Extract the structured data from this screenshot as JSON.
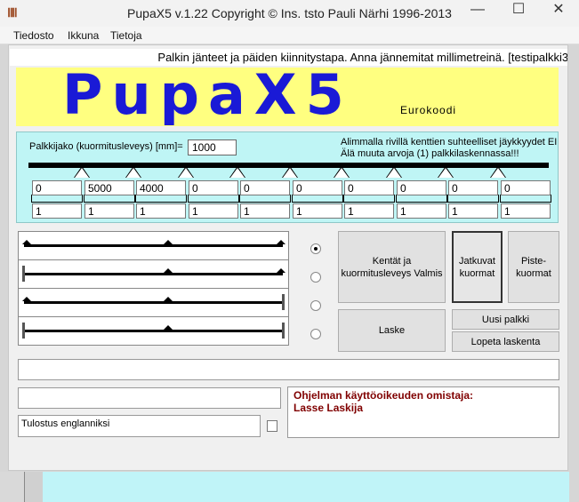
{
  "window": {
    "app_icon": "ⅡⅡ",
    "title": "PupaX5 v.1.22    Copyright © Ins. tsto Pauli Närhi 1996-2013",
    "controls": [
      "minimize",
      "maximize",
      "close"
    ]
  },
  "menu": [
    "Tiedosto",
    "Ikkuna",
    "Tietoja"
  ],
  "header_text": "Palkin jänteet ja päiden kiinnitystapa. Anna jännemitat millimetreinä. [testipalkki3...",
  "logo": {
    "title": "PupaX5",
    "subtitle": "Eurokoodi"
  },
  "beam": {
    "spacing_label": "Palkkijako (kuormitusleveys) [mm]=",
    "spacing_value": "1000",
    "note_line1": "Alimmalla rivillä kenttien suhteelliset jäykkyydet EI",
    "note_line2": "Älä muuta arvoja (1) palkkilaskennassa!!!",
    "spans": [
      "0",
      "5000",
      "4000",
      "0",
      "0",
      "0",
      "0",
      "0",
      "0",
      "0"
    ],
    "stiffness": [
      "1",
      "1",
      "1",
      "1",
      "1",
      "1",
      "1",
      "1",
      "1",
      "1"
    ]
  },
  "support_types": {
    "options": [
      "simply-supported",
      "fixed-left",
      "fixed-right",
      "fixed-both"
    ],
    "selected_index": 0
  },
  "buttons": {
    "fields_ready": "Kentät ja kuormitusleveys Valmis",
    "continuous_loads": "Jatkuvat kuormat",
    "point_loads": "Piste-kuormat",
    "calculate": "Laske",
    "new_beam": "Uusi palkki",
    "stop_calculation": "Lopeta laskenta"
  },
  "status_field": "",
  "secondary_field": "",
  "output_english_label": "Tulostus englanniksi",
  "output_english_checked": false,
  "owner": {
    "heading": "Ohjelman käyttöoikeuden omistaja:",
    "name": "Lasse Laskija"
  },
  "colors": {
    "logo_background": "#ffff80",
    "logo_text": "#1a1ad6",
    "beam_panel": "#bff5f5",
    "owner_text": "#800000"
  }
}
